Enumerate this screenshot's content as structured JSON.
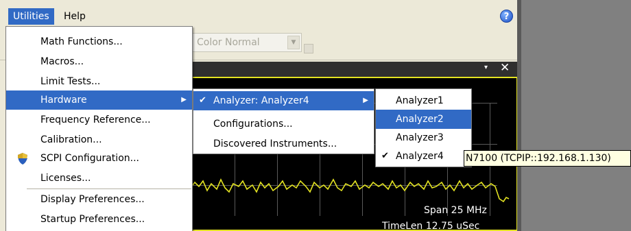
{
  "menubar": {
    "utilities_label": "Utilities",
    "help_label": "Help",
    "help_icon_glyph": "?"
  },
  "toolbar": {
    "color_select_value": "Color Normal",
    "dropdown_glyph": "▼"
  },
  "panel": {
    "pin_glyph": "▾",
    "close_glyph": "✕"
  },
  "display": {
    "span_text": "Span 25 MHz",
    "timelen_text": "TimeLen 12.75 uSec",
    "trace_color": "#e3e322"
  },
  "utilities_menu": {
    "items": [
      {
        "label": "Math Functions..."
      },
      {
        "label": "Macros..."
      },
      {
        "label": "Limit Tests..."
      },
      {
        "label": "Hardware",
        "submenu_arrow": "▶"
      },
      {
        "label": "Frequency Reference..."
      },
      {
        "label": "Calibration..."
      },
      {
        "label": "SCPI Configuration...",
        "icon": "shield-icon"
      },
      {
        "label": "Licenses..."
      },
      {
        "label": "Display Preferences..."
      },
      {
        "label": "Startup Preferences..."
      }
    ]
  },
  "hardware_menu": {
    "items": [
      {
        "label": "Analyzer: Analyzer4",
        "check": "✔",
        "submenu_arrow": "▶"
      },
      {
        "label": "Configurations..."
      },
      {
        "label": "Discovered Instruments..."
      }
    ]
  },
  "analyzer_menu": {
    "items": [
      {
        "label": "Analyzer1"
      },
      {
        "label": "Analyzer2"
      },
      {
        "label": "Analyzer3"
      },
      {
        "label": "Analyzer4",
        "check": "✔"
      }
    ]
  },
  "tooltip": {
    "text": "N7100 (TCPIP::192.168.1.130)"
  },
  "colors": {
    "highlight": "#316ac5",
    "menu_bg": "#ece9d8",
    "trace": "#e3e322"
  }
}
